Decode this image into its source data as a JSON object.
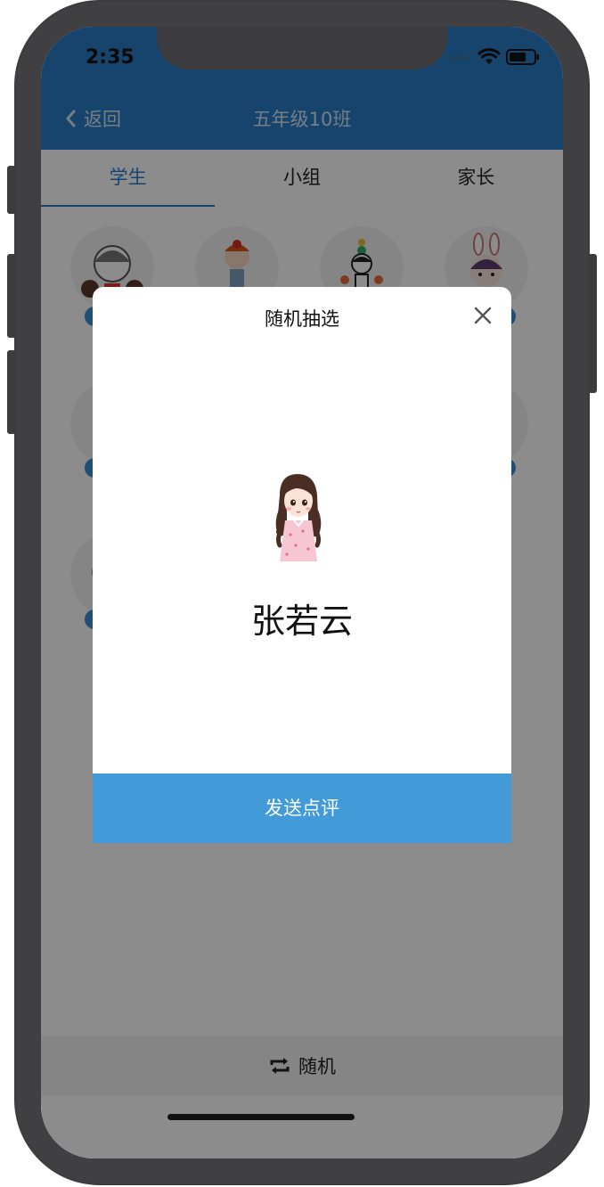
{
  "status_bar": {
    "time": "2:35"
  },
  "nav": {
    "back_label": "返回",
    "title": "五年级10班"
  },
  "tabs": [
    {
      "label": "学生",
      "active": true
    },
    {
      "label": "小组",
      "active": false
    },
    {
      "label": "家长",
      "active": false
    }
  ],
  "bottom_bar": {
    "icon": "shuffle-icon",
    "label": "随机"
  },
  "modal": {
    "title": "随机抽选",
    "student_name": "张若云",
    "send_button_label": "发送点评"
  },
  "colors": {
    "nav_bar": "#2a7cc6",
    "accent": "#429bd8",
    "tab_active": "#2a7cc6",
    "overlay": "rgba(0,0,0,0.45)"
  }
}
